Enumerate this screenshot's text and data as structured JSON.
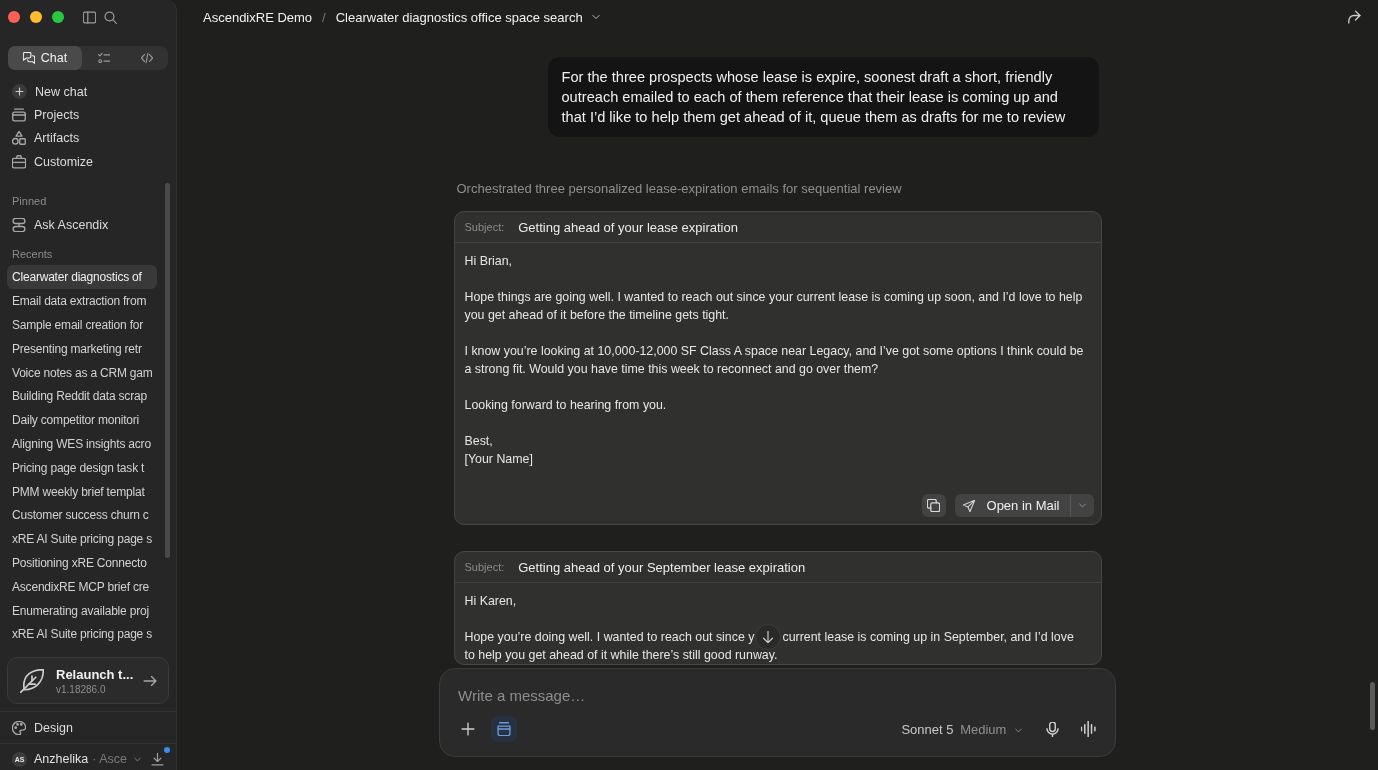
{
  "sidebar": {
    "mode_tabs": [
      {
        "kind": "chat",
        "label": "Chat",
        "selected": true
      },
      {
        "kind": "tasks",
        "selected": false
      },
      {
        "kind": "code",
        "selected": false
      }
    ],
    "nav": [
      {
        "kind": "new_chat",
        "label": "New chat"
      },
      {
        "kind": "projects",
        "label": "Projects"
      },
      {
        "kind": "artifacts",
        "label": "Artifacts"
      },
      {
        "kind": "customize",
        "label": "Customize"
      }
    ],
    "pinned": {
      "heading": "Pinned",
      "items": [
        {
          "label": "Ask Ascendix"
        }
      ]
    },
    "recents": {
      "heading": "Recents",
      "items": [
        {
          "label": "Clearwater diagnostics of",
          "selected": true
        },
        {
          "label": "Email data extraction from",
          "selected": false
        },
        {
          "label": "Sample email creation for",
          "selected": false
        },
        {
          "label": "Presenting marketing retr",
          "selected": false
        },
        {
          "label": "Voice notes as a CRM gam",
          "selected": false
        },
        {
          "label": "Building Reddit data scrap",
          "selected": false
        },
        {
          "label": "Daily competitor monitori",
          "selected": false
        },
        {
          "label": "Aligning WES insights acro",
          "selected": false
        },
        {
          "label": "Pricing page design task t",
          "selected": false
        },
        {
          "label": "PMM weekly brief templat",
          "selected": false
        },
        {
          "label": "Customer success churn c",
          "selected": false
        },
        {
          "label": "xRE AI Suite pricing page s",
          "selected": false
        },
        {
          "label": "Positioning xRE Connecto",
          "selected": false
        },
        {
          "label": "AscendixRE MCP brief cre",
          "selected": false
        },
        {
          "label": "Enumerating available proj",
          "selected": false
        },
        {
          "label": "xRE AI Suite pricing page s",
          "selected": false
        }
      ]
    },
    "update_card": {
      "title": "Relaunch t...",
      "version": "v1.18286.0"
    },
    "footer_link": {
      "label": "Design"
    },
    "account": {
      "initials": "AS",
      "name": "Anzhelika",
      "organization": "· Asce",
      "download_notification": true
    }
  },
  "header": {
    "project": "AscendixRE Demo",
    "separator": "/",
    "chat_title": "Clearwater diagnostics office space search"
  },
  "conversation": {
    "user_message": "For the three prospects whose lease is expire, soonest draft a short, friendly outreach emailed to each of them reference that their lease is coming up and that I’d like to help them get ahead of it, queue them as drafts for me to review",
    "summary": "Orchestrated three personalized lease-expiration emails for sequential review",
    "emails": [
      {
        "subject_label": "Subject:",
        "subject": "Getting ahead of your lease expiration",
        "paragraphs": [
          {
            "text": "Hi Brian,"
          },
          {
            "text": "Hope things are going well. I wanted to reach out since your current lease is coming up soon, and I’d love to help you get ahead of it before the timeline gets tight."
          },
          {
            "text": "I know you’re looking at 10,000-12,000 SF Class A space near Legacy, and I’ve got some options I think could be a strong fit. Would you have time this week to reconnect and go over them?"
          },
          {
            "text": "Looking forward to hearing from you."
          },
          {
            "text": "Best,\n[Your Name]"
          }
        ],
        "actions": {
          "open_label": "Open in Mail"
        }
      },
      {
        "subject_label": "Subject:",
        "subject": "Getting ahead of your September lease expiration",
        "paragraphs": [
          {
            "text": "Hi Karen,"
          },
          {
            "kind": "interrupted",
            "segments": [
              "Hope you’re doing well. I wanted to reach out since y",
              "current lease is coming up in September, and I’d love",
              "to help you get ahead of it while there’s still good runway."
            ]
          }
        ]
      }
    ]
  },
  "composer": {
    "placeholder": "Write a message…",
    "model": "Sonnet 5",
    "effort": "Medium"
  }
}
